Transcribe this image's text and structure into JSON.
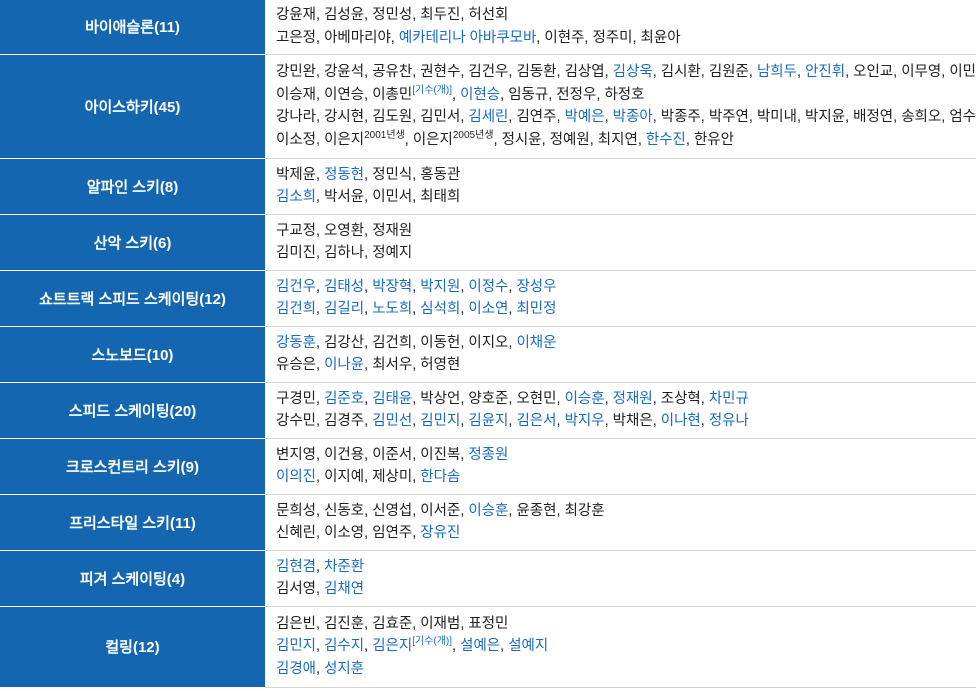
{
  "sports": [
    {
      "label": "바이애슬론(11)",
      "lines": [
        [
          {
            "t": "강윤재"
          },
          {
            "t": "김성윤"
          },
          {
            "t": "정민성"
          },
          {
            "t": "최두진"
          },
          {
            "t": "허선회"
          }
        ],
        [
          {
            "t": "고은정"
          },
          {
            "t": "아베마리야"
          },
          {
            "t": "예카테리나 아바쿠모바",
            "link": true
          },
          {
            "t": "이현주"
          },
          {
            "t": "정주미"
          },
          {
            "t": "최윤아"
          }
        ]
      ]
    },
    {
      "label": "아이스하키(45)",
      "lines": [
        [
          {
            "t": "강민완"
          },
          {
            "t": "강윤석"
          },
          {
            "t": "공유찬"
          },
          {
            "t": "권현수"
          },
          {
            "t": "김건우"
          },
          {
            "t": "김동환"
          },
          {
            "t": "김상엽"
          },
          {
            "t": "김상욱",
            "link": true
          },
          {
            "t": "김시환"
          },
          {
            "t": "김원준"
          },
          {
            "t": "남희두",
            "link": true
          },
          {
            "t": "안진휘",
            "link": true
          },
          {
            "t": "오인교"
          },
          {
            "t": "이무영"
          },
          {
            "t": "이민재"
          }
        ],
        [
          {
            "t": "이승재"
          },
          {
            "t": "이연승"
          },
          {
            "t": "이총민",
            "sup": "[기수(개)]",
            "supLink": true
          },
          {
            "t": "이현승",
            "link": true
          },
          {
            "t": "임동규"
          },
          {
            "t": "전정우"
          },
          {
            "t": "하정호"
          }
        ],
        [
          {
            "t": "강나라"
          },
          {
            "t": "강시현"
          },
          {
            "t": "김도원"
          },
          {
            "t": "김민서"
          },
          {
            "t": "김세린",
            "link": true
          },
          {
            "t": "김연주"
          },
          {
            "t": "박예은",
            "link": true
          },
          {
            "t": "박종아",
            "link": true
          },
          {
            "t": "박종주"
          },
          {
            "t": "박주연"
          },
          {
            "t": "박미내"
          },
          {
            "t": "박지윤"
          },
          {
            "t": "배정연"
          },
          {
            "t": "송희오"
          },
          {
            "t": "엄수연"
          }
        ],
        [
          {
            "t": "이소정"
          },
          {
            "t": "이은지",
            "sup": "2001년생"
          },
          {
            "t": "이은지",
            "sup": "2005년생"
          },
          {
            "t": "정시윤"
          },
          {
            "t": "정예원"
          },
          {
            "t": "최지연"
          },
          {
            "t": "한수진",
            "link": true
          },
          {
            "t": "한유안"
          }
        ]
      ]
    },
    {
      "label": "알파인 스키(8)",
      "lines": [
        [
          {
            "t": "박제윤"
          },
          {
            "t": "정동현",
            "link": true
          },
          {
            "t": "정민식"
          },
          {
            "t": "홍동관"
          }
        ],
        [
          {
            "t": "김소희",
            "link": true
          },
          {
            "t": "박서윤"
          },
          {
            "t": "이민서"
          },
          {
            "t": "최태희"
          }
        ]
      ]
    },
    {
      "label": "산악 스키(6)",
      "lines": [
        [
          {
            "t": "구교정"
          },
          {
            "t": "오영환"
          },
          {
            "t": "정재원"
          }
        ],
        [
          {
            "t": "김미진"
          },
          {
            "t": "김하나"
          },
          {
            "t": "정예지"
          }
        ]
      ]
    },
    {
      "label": "쇼트트랙 스피드 스케이팅(12)",
      "lines": [
        [
          {
            "t": "김건우",
            "link": true
          },
          {
            "t": "김태성",
            "link": true
          },
          {
            "t": "박장혁",
            "link": true
          },
          {
            "t": "박지원",
            "link": true
          },
          {
            "t": "이정수",
            "link": true
          },
          {
            "t": "장성우",
            "link": true
          }
        ],
        [
          {
            "t": "김건희",
            "link": true
          },
          {
            "t": "김길리",
            "link": true
          },
          {
            "t": "노도희",
            "link": true
          },
          {
            "t": "심석희",
            "link": true
          },
          {
            "t": "이소연",
            "link": true
          },
          {
            "t": "최민정",
            "link": true
          }
        ]
      ]
    },
    {
      "label": "스노보드(10)",
      "lines": [
        [
          {
            "t": "강동훈",
            "link": true
          },
          {
            "t": "김강산"
          },
          {
            "t": "김건희"
          },
          {
            "t": "이동헌"
          },
          {
            "t": "이지오"
          },
          {
            "t": "이채운",
            "link": true
          }
        ],
        [
          {
            "t": "유승은"
          },
          {
            "t": "이나윤",
            "link": true
          },
          {
            "t": "최서우"
          },
          {
            "t": "허영현"
          }
        ]
      ]
    },
    {
      "label": "스피드 스케이팅(20)",
      "lines": [
        [
          {
            "t": "구경민"
          },
          {
            "t": "김준호",
            "link": true
          },
          {
            "t": "김태윤",
            "link": true
          },
          {
            "t": "박상언"
          },
          {
            "t": "양호준"
          },
          {
            "t": "오현민"
          },
          {
            "t": "이승훈",
            "link": true
          },
          {
            "t": "정재원",
            "link": true
          },
          {
            "t": "조상혁"
          },
          {
            "t": "차민규",
            "link": true
          }
        ],
        [
          {
            "t": "강수민"
          },
          {
            "t": "김경주"
          },
          {
            "t": "김민선",
            "link": true
          },
          {
            "t": "김민지",
            "link": true
          },
          {
            "t": "김윤지",
            "link": true
          },
          {
            "t": "김은서",
            "link": true
          },
          {
            "t": "박지우",
            "link": true
          },
          {
            "t": "박채은"
          },
          {
            "t": "이나현",
            "link": true
          },
          {
            "t": "정유나",
            "link": true
          }
        ]
      ]
    },
    {
      "label": "크로스컨트리 스키(9)",
      "lines": [
        [
          {
            "t": "변지영"
          },
          {
            "t": "이건용"
          },
          {
            "t": "이준서"
          },
          {
            "t": "이진복"
          },
          {
            "t": "정종원",
            "link": true
          }
        ],
        [
          {
            "t": "이의진",
            "link": true
          },
          {
            "t": "이지예"
          },
          {
            "t": "제상미"
          },
          {
            "t": "한다솜",
            "link": true
          }
        ]
      ]
    },
    {
      "label": "프리스타일 스키(11)",
      "lines": [
        [
          {
            "t": "문희성"
          },
          {
            "t": "신동호"
          },
          {
            "t": "신영섭"
          },
          {
            "t": "이서준"
          },
          {
            "t": "이승훈",
            "link": true
          },
          {
            "t": "윤종현"
          },
          {
            "t": "최강훈"
          }
        ],
        [
          {
            "t": "신혜린"
          },
          {
            "t": "이소영"
          },
          {
            "t": "임연주"
          },
          {
            "t": "장유진",
            "link": true
          }
        ]
      ]
    },
    {
      "label": "피겨 스케이팅(4)",
      "lines": [
        [
          {
            "t": "김현겸",
            "link": true
          },
          {
            "t": "차준환",
            "link": true
          }
        ],
        [
          {
            "t": "김서영"
          },
          {
            "t": "김채연",
            "link": true
          }
        ]
      ]
    },
    {
      "label": "컬링(12)",
      "lines": [
        [
          {
            "t": "김은빈"
          },
          {
            "t": "김진훈"
          },
          {
            "t": "김효준"
          },
          {
            "t": "이재범"
          },
          {
            "t": "표정민"
          }
        ],
        [
          {
            "t": "김민지",
            "link": true
          },
          {
            "t": "김수지",
            "link": true
          },
          {
            "t": "김은지",
            "link": true,
            "sup": "[기수(개)]",
            "supLink": true
          },
          {
            "t": "설예은",
            "link": true
          },
          {
            "t": "설예지",
            "link": true
          }
        ],
        [
          {
            "t": "김경애",
            "link": true
          },
          {
            "t": "성지훈",
            "link": true
          }
        ]
      ]
    }
  ]
}
